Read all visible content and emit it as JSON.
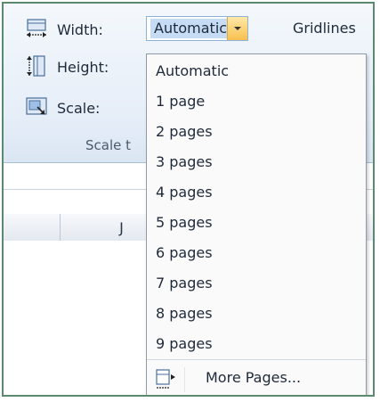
{
  "ribbon": {
    "width_label": "Width:",
    "height_label": "Height:",
    "scale_label": "Scale:",
    "width_value": "Automatic",
    "gridlines_label": "Gridlines",
    "group_label": "Scale t"
  },
  "sheet": {
    "column_j": "J"
  },
  "menu": {
    "items": [
      "Automatic",
      "1 page",
      "2 pages",
      "3 pages",
      "4 pages",
      "5 pages",
      "6 pages",
      "7 pages",
      "8 pages",
      "9 pages"
    ],
    "more_label": "More Pages..."
  },
  "icons": {
    "width": "width-icon",
    "height": "height-icon",
    "scale": "scale-icon",
    "dropdown": "chevron-down-icon",
    "more": "more-pages-icon"
  },
  "colors": {
    "frame": "#5b8a6e",
    "selection": "#c6dcf5",
    "dropdown_button": "#f7c04f"
  }
}
